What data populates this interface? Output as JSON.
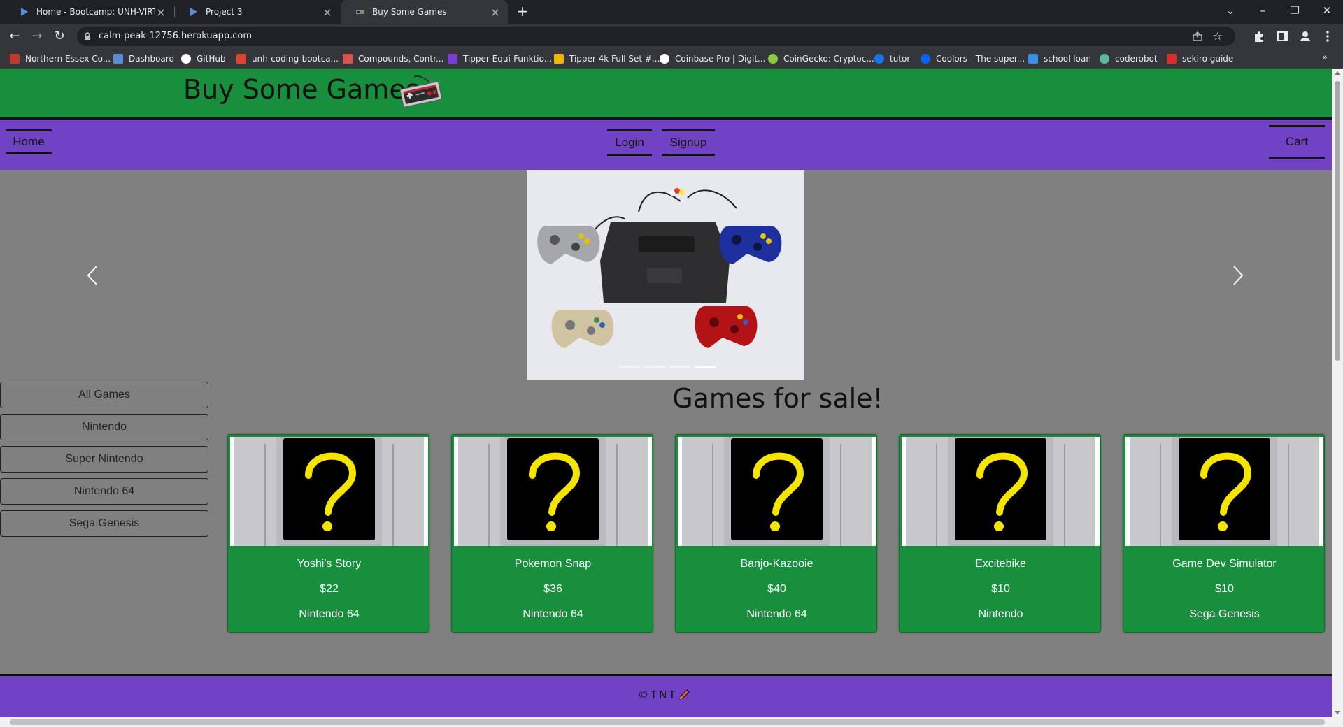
{
  "browser": {
    "tabs": [
      {
        "title": "Home - Bootcamp: UNH-VIRT-FS",
        "active": false
      },
      {
        "title": "Project 3",
        "active": false
      },
      {
        "title": "Buy Some Games",
        "active": true
      }
    ],
    "new_tab_symbol": "+",
    "url": "calm-peak-12756.herokuapp.com",
    "bookmarks": [
      {
        "label": "Northern Essex Co...",
        "icon": "neco-icon",
        "color": "#c0392b"
      },
      {
        "label": "Dashboard",
        "icon": "canvas-icon",
        "color": "#5b8bd8"
      },
      {
        "label": "GitHub",
        "icon": "github-icon",
        "color": "#ffffff"
      },
      {
        "label": "unh-coding-bootca...",
        "icon": "gitlab-icon",
        "color": "#e24329"
      },
      {
        "label": "Compounds, Contr...",
        "icon": "compounds-icon",
        "color": "#d9534f"
      },
      {
        "label": "Tipper Equi-Funktio...",
        "icon": "tipper-icon",
        "color": "#7a3fd1"
      },
      {
        "label": "Tipper 4k Full Set #...",
        "icon": "drive-icon",
        "color": "#f4b400"
      },
      {
        "label": "Coinbase Pro | Digit...",
        "icon": "coinbase-icon",
        "color": "#ffffff"
      },
      {
        "label": "CoinGecko: Cryptoc...",
        "icon": "coingecko-icon",
        "color": "#8dc63f"
      },
      {
        "label": "tutor",
        "icon": "tutor-icon",
        "color": "#1a73e8"
      },
      {
        "label": "Coolors - The super...",
        "icon": "coolors-icon",
        "color": "#0066ff"
      },
      {
        "label": "school loan",
        "icon": "loan-icon",
        "color": "#3a8ee6"
      },
      {
        "label": "coderobot",
        "icon": "coderobot-icon",
        "color": "#5fb8a0"
      },
      {
        "label": "sekiro guide",
        "icon": "sekiro-icon",
        "color": "#d93025"
      }
    ],
    "bookmarks_more": "»"
  },
  "site": {
    "title": "Buy Some Games",
    "nav": {
      "home": "Home",
      "login": "Login",
      "signup": "Signup",
      "cart": "Cart"
    },
    "carousel": {
      "slide_count": 4,
      "active_index": 3
    },
    "categories": [
      "All Games",
      "Nintendo",
      "Super Nintendo",
      "Nintendo 64",
      "Sega Genesis"
    ],
    "games_heading": "Games for sale!",
    "games": [
      {
        "name": "Yoshi's Story",
        "price": "$22",
        "platform": "Nintendo 64"
      },
      {
        "name": "Pokemon Snap",
        "price": "$36",
        "platform": "Nintendo 64"
      },
      {
        "name": "Banjo-Kazooie",
        "price": "$40",
        "platform": "Nintendo 64"
      },
      {
        "name": "Excitebike",
        "price": "$10",
        "platform": "Nintendo"
      },
      {
        "name": "Game Dev Simulator",
        "price": "$10",
        "platform": "Sega Genesis"
      }
    ],
    "footer": "©TNT"
  },
  "colors": {
    "header_green": "#178f3c",
    "nav_purple": "#7143c4",
    "page_gray": "#808080",
    "question_yellow": "#f5e400"
  }
}
